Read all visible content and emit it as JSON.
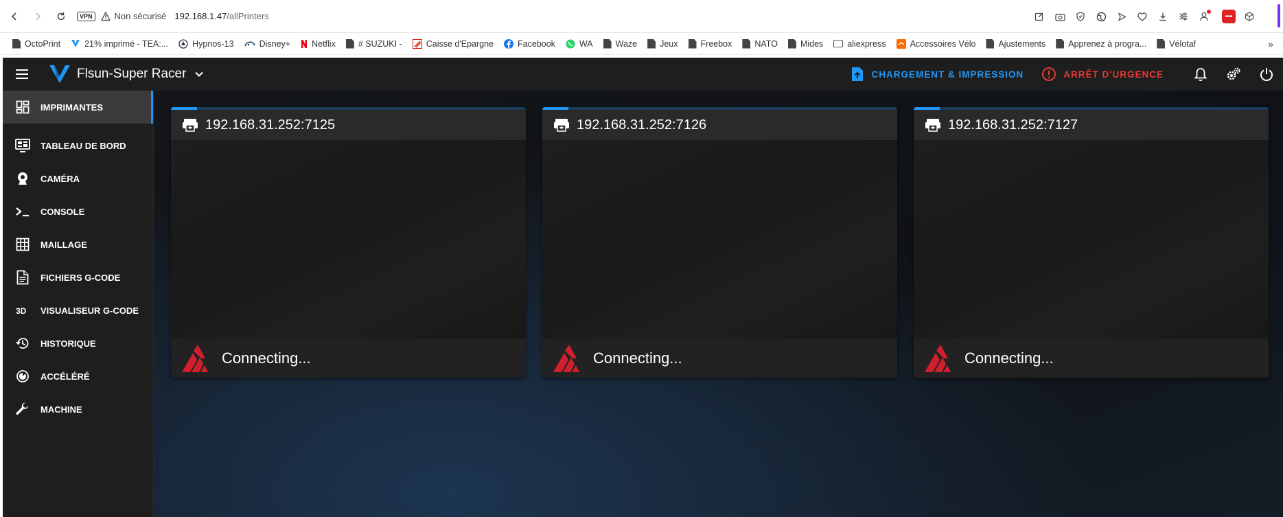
{
  "browser": {
    "vpn_label": "VPN",
    "security_text": "Non sécurisé",
    "url_host": "192.168.1.47",
    "url_path": "/allPrinters"
  },
  "bookmarks": [
    {
      "label": "OctoPrint",
      "icon": "page"
    },
    {
      "label": "21% imprimé - TEA:...",
      "icon": "v-logo"
    },
    {
      "label": "Hypnos-13",
      "icon": "hypnos"
    },
    {
      "label": "Disney+",
      "icon": "disney"
    },
    {
      "label": "Netflix",
      "icon": "netflix"
    },
    {
      "label": "# SUZUKI -",
      "icon": "page"
    },
    {
      "label": "Caisse d'Epargne",
      "icon": "caisse"
    },
    {
      "label": "Facebook",
      "icon": "facebook"
    },
    {
      "label": "WA",
      "icon": "whatsapp"
    },
    {
      "label": "Waze",
      "icon": "page"
    },
    {
      "label": "Jeux",
      "icon": "page"
    },
    {
      "label": "Freebox",
      "icon": "page"
    },
    {
      "label": "NATO",
      "icon": "page"
    },
    {
      "label": "Mides",
      "icon": "page"
    },
    {
      "label": "aliexpress",
      "icon": "folder"
    },
    {
      "label": "Accessoires Vélo",
      "icon": "orange"
    },
    {
      "label": "Ajustements",
      "icon": "page"
    },
    {
      "label": "Apprenez à progra...",
      "icon": "page"
    },
    {
      "label": "Vélotaf",
      "icon": "page"
    }
  ],
  "app": {
    "printer_name": "Flsun-Super Racer",
    "upload_label": "CHARGEMENT & IMPRESSION",
    "estop_label": "ARRÊT D'URGENCE",
    "colors": {
      "accent": "#2196f3",
      "danger": "#e53935",
      "klipper_red": "#d01f2d"
    }
  },
  "sidebar": {
    "items": [
      {
        "label": "IMPRIMANTES",
        "icon": "dashboard-grid-icon",
        "active": true
      },
      {
        "label": "TABLEAU DE BORD",
        "icon": "monitor-dashboard-icon"
      },
      {
        "label": "CAMÉRA",
        "icon": "webcam-icon"
      },
      {
        "label": "CONSOLE",
        "icon": "console-icon"
      },
      {
        "label": "MAILLAGE",
        "icon": "grid-icon"
      },
      {
        "label": "FICHIERS G-CODE",
        "icon": "file-document-icon"
      },
      {
        "label": "VISUALISEUR G-CODE",
        "icon": "3d-icon"
      },
      {
        "label": "HISTORIQUE",
        "icon": "history-icon"
      },
      {
        "label": "ACCÉLÉRÉ",
        "icon": "timelapse-icon"
      },
      {
        "label": "MACHINE",
        "icon": "wrench-icon"
      }
    ]
  },
  "printers": [
    {
      "address": "192.168.31.252:7125",
      "status": "Connecting..."
    },
    {
      "address": "192.168.31.252:7126",
      "status": "Connecting..."
    },
    {
      "address": "192.168.31.252:7127",
      "status": "Connecting..."
    }
  ]
}
